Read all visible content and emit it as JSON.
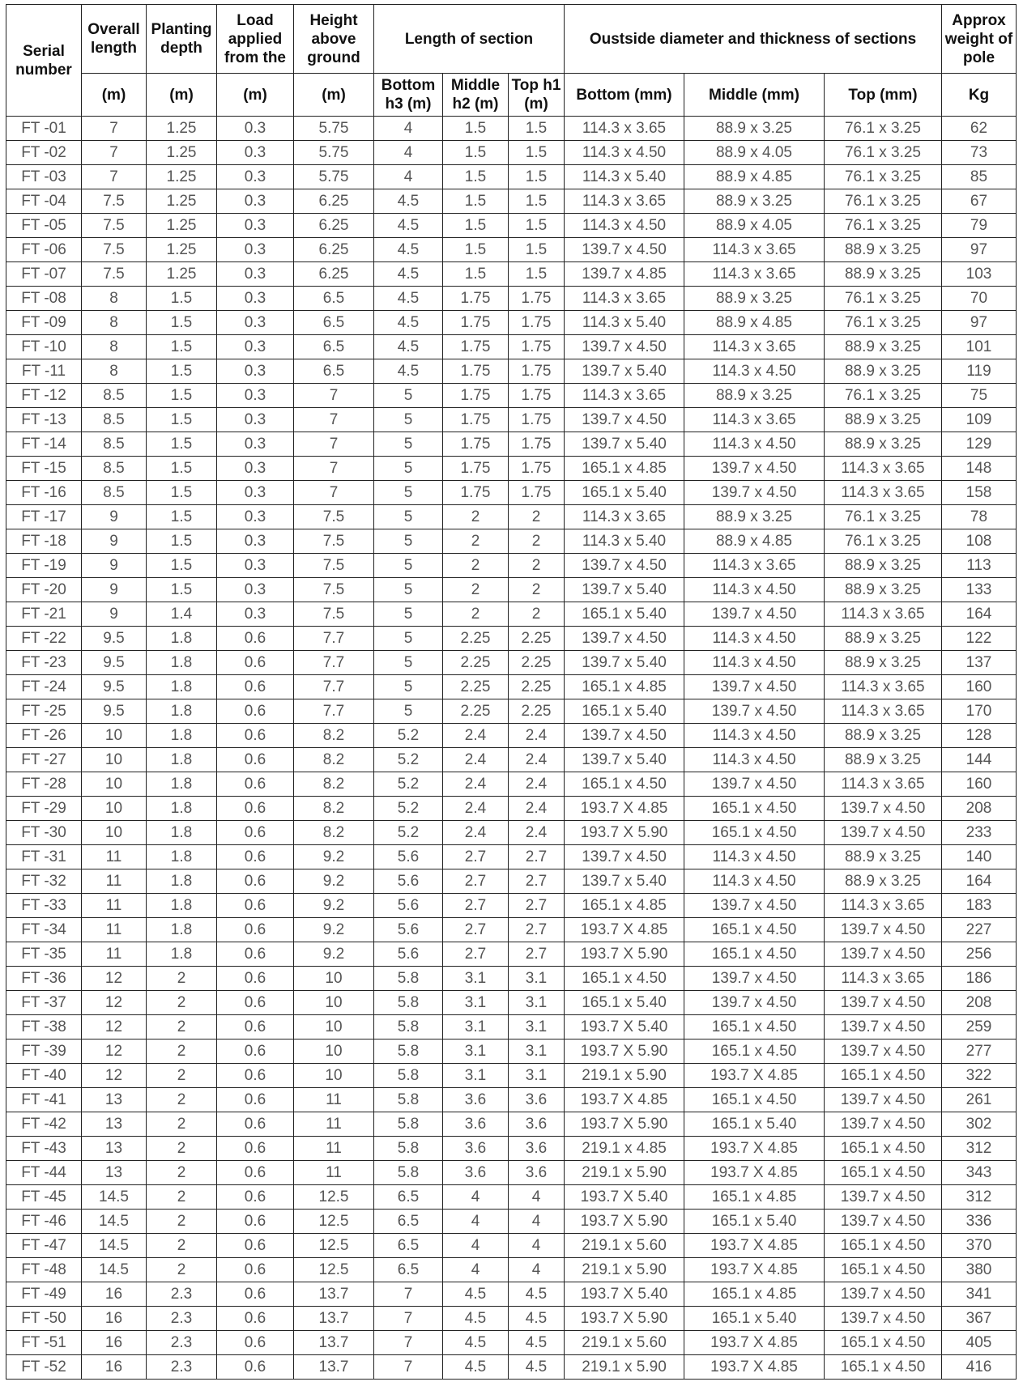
{
  "header": {
    "serial": "Serial number",
    "overall": "Overall length",
    "planting": "Planting depth",
    "load": "Load applied from the",
    "height": "Height above ground",
    "section_length": "Length of section",
    "diameter": "Oustside diameter and thickness of sections",
    "weight": "Approx weight of pole",
    "units": [
      "(m)",
      "(m)",
      "(m)",
      "(m)",
      "Bottom h3 (m)",
      "Middle h2 (m)",
      "Top h1 (m)",
      "Bottom (mm)",
      "Middle (mm)",
      "Top (mm)",
      "Kg"
    ]
  },
  "rows": [
    [
      "FT -01",
      "7",
      "1.25",
      "0.3",
      "5.75",
      "4",
      "1.5",
      "1.5",
      "114.3 x 3.65",
      "88.9 x 3.25",
      "76.1 x 3.25",
      "62"
    ],
    [
      "FT -02",
      "7",
      "1.25",
      "0.3",
      "5.75",
      "4",
      "1.5",
      "1.5",
      "114.3 x 4.50",
      "88.9 x 4.05",
      "76.1 x 3.25",
      "73"
    ],
    [
      "FT -03",
      "7",
      "1.25",
      "0.3",
      "5.75",
      "4",
      "1.5",
      "1.5",
      "114.3 x 5.40",
      "88.9 x 4.85",
      "76.1 x 3.25",
      "85"
    ],
    [
      "FT -04",
      "7.5",
      "1.25",
      "0.3",
      "6.25",
      "4.5",
      "1.5",
      "1.5",
      "114.3 x 3.65",
      "88.9 x 3.25",
      "76.1 x 3.25",
      "67"
    ],
    [
      "FT -05",
      "7.5",
      "1.25",
      "0.3",
      "6.25",
      "4.5",
      "1.5",
      "1.5",
      "114.3 x 4.50",
      "88.9 x 4.05",
      "76.1 x 3.25",
      "79"
    ],
    [
      "FT -06",
      "7.5",
      "1.25",
      "0.3",
      "6.25",
      "4.5",
      "1.5",
      "1.5",
      "139.7 x 4.50",
      "114.3 x 3.65",
      "88.9 x 3.25",
      "97"
    ],
    [
      "FT -07",
      "7.5",
      "1.25",
      "0.3",
      "6.25",
      "4.5",
      "1.5",
      "1.5",
      "139.7 x 4.85",
      "114.3 x 3.65",
      "88.9 x 3.25",
      "103"
    ],
    [
      "FT -08",
      "8",
      "1.5",
      "0.3",
      "6.5",
      "4.5",
      "1.75",
      "1.75",
      "114.3 x 3.65",
      "88.9 x 3.25",
      "76.1 x 3.25",
      "70"
    ],
    [
      "FT -09",
      "8",
      "1.5",
      "0.3",
      "6.5",
      "4.5",
      "1.75",
      "1.75",
      "114.3 x 5.40",
      "88.9 x 4.85",
      "76.1 x 3.25",
      "97"
    ],
    [
      "FT -10",
      "8",
      "1.5",
      "0.3",
      "6.5",
      "4.5",
      "1.75",
      "1.75",
      "139.7 x 4.50",
      "114.3 x 3.65",
      "88.9 x 3.25",
      "101"
    ],
    [
      "FT -11",
      "8",
      "1.5",
      "0.3",
      "6.5",
      "4.5",
      "1.75",
      "1.75",
      "139.7 x 5.40",
      "114.3 x 4.50",
      "88.9 x 3.25",
      "119"
    ],
    [
      "FT -12",
      "8.5",
      "1.5",
      "0.3",
      "7",
      "5",
      "1.75",
      "1.75",
      "114.3 x 3.65",
      "88.9 x 3.25",
      "76.1 x 3.25",
      "75"
    ],
    [
      "FT -13",
      "8.5",
      "1.5",
      "0.3",
      "7",
      "5",
      "1.75",
      "1.75",
      "139.7 x 4.50",
      "114.3 x 3.65",
      "88.9 x 3.25",
      "109"
    ],
    [
      "FT -14",
      "8.5",
      "1.5",
      "0.3",
      "7",
      "5",
      "1.75",
      "1.75",
      "139.7 x 5.40",
      "114.3 x 4.50",
      "88.9 x 3.25",
      "129"
    ],
    [
      "FT -15",
      "8.5",
      "1.5",
      "0.3",
      "7",
      "5",
      "1.75",
      "1.75",
      "165.1 x 4.85",
      "139.7 x 4.50",
      "114.3 x 3.65",
      "148"
    ],
    [
      "FT -16",
      "8.5",
      "1.5",
      "0.3",
      "7",
      "5",
      "1.75",
      "1.75",
      "165.1 x 5.40",
      "139.7 x 4.50",
      "114.3 x 3.65",
      "158"
    ],
    [
      "FT -17",
      "9",
      "1.5",
      "0.3",
      "7.5",
      "5",
      "2",
      "2",
      "114.3 x 3.65",
      "88.9 x 3.25",
      "76.1 x 3.25",
      "78"
    ],
    [
      "FT -18",
      "9",
      "1.5",
      "0.3",
      "7.5",
      "5",
      "2",
      "2",
      "114.3 x 5.40",
      "88.9 x 4.85",
      "76.1 x 3.25",
      "108"
    ],
    [
      "FT -19",
      "9",
      "1.5",
      "0.3",
      "7.5",
      "5",
      "2",
      "2",
      "139.7 x 4.50",
      "114.3 x 3.65",
      "88.9 x 3.25",
      "113"
    ],
    [
      "FT -20",
      "9",
      "1.5",
      "0.3",
      "7.5",
      "5",
      "2",
      "2",
      "139.7 x 5.40",
      "114.3 x 4.50",
      "88.9 x 3.25",
      "133"
    ],
    [
      "FT -21",
      "9",
      "1.4",
      "0.3",
      "7.5",
      "5",
      "2",
      "2",
      "165.1 x 5.40",
      "139.7 x 4.50",
      "114.3 x 3.65",
      "164"
    ],
    [
      "FT -22",
      "9.5",
      "1.8",
      "0.6",
      "7.7",
      "5",
      "2.25",
      "2.25",
      "139.7 x 4.50",
      "114.3 x 4.50",
      "88.9 x 3.25",
      "122"
    ],
    [
      "FT -23",
      "9.5",
      "1.8",
      "0.6",
      "7.7",
      "5",
      "2.25",
      "2.25",
      "139.7 x 5.40",
      "114.3 x 4.50",
      "88.9 x 3.25",
      "137"
    ],
    [
      "FT -24",
      "9.5",
      "1.8",
      "0.6",
      "7.7",
      "5",
      "2.25",
      "2.25",
      "165.1 x 4.85",
      "139.7 x 4.50",
      "114.3 x 3.65",
      "160"
    ],
    [
      "FT -25",
      "9.5",
      "1.8",
      "0.6",
      "7.7",
      "5",
      "2.25",
      "2.25",
      "165.1 x 5.40",
      "139.7 x 4.50",
      "114.3 x 3.65",
      "170"
    ],
    [
      "FT -26",
      "10",
      "1.8",
      "0.6",
      "8.2",
      "5.2",
      "2.4",
      "2.4",
      "139.7 x 4.50",
      "114.3 x 4.50",
      "88.9 x 3.25",
      "128"
    ],
    [
      "FT -27",
      "10",
      "1.8",
      "0.6",
      "8.2",
      "5.2",
      "2.4",
      "2.4",
      "139.7 x 5.40",
      "114.3 x 4.50",
      "88.9 x 3.25",
      "144"
    ],
    [
      "FT -28",
      "10",
      "1.8",
      "0.6",
      "8.2",
      "5.2",
      "2.4",
      "2.4",
      "165.1 x 4.50",
      "139.7 x 4.50",
      "114.3 x 3.65",
      "160"
    ],
    [
      "FT -29",
      "10",
      "1.8",
      "0.6",
      "8.2",
      "5.2",
      "2.4",
      "2.4",
      "193.7  X 4.85",
      "165.1 x 4.50",
      "139.7 x 4.50",
      "208"
    ],
    [
      "FT -30",
      "10",
      "1.8",
      "0.6",
      "8.2",
      "5.2",
      "2.4",
      "2.4",
      "193.7  X 5.90",
      "165.1 x 4.50",
      "139.7 x 4.50",
      "233"
    ],
    [
      "FT -31",
      "11",
      "1.8",
      "0.6",
      "9.2",
      "5.6",
      "2.7",
      "2.7",
      "139.7 x 4.50",
      "114.3 x 4.50",
      "88.9 x 3.25",
      "140"
    ],
    [
      "FT -32",
      "11",
      "1.8",
      "0.6",
      "9.2",
      "5.6",
      "2.7",
      "2.7",
      "139.7 x 5.40",
      "114.3 x 4.50",
      "88.9 x 3.25",
      "164"
    ],
    [
      "FT -33",
      "11",
      "1.8",
      "0.6",
      "9.2",
      "5.6",
      "2.7",
      "2.7",
      "165.1 x 4.85",
      "139.7 x 4.50",
      "114.3 x 3.65",
      "183"
    ],
    [
      "FT -34",
      "11",
      "1.8",
      "0.6",
      "9.2",
      "5.6",
      "2.7",
      "2.7",
      "193.7  X 4.85",
      "165.1 x 4.50",
      "139.7 x 4.50",
      "227"
    ],
    [
      "FT -35",
      "11",
      "1.8",
      "0.6",
      "9.2",
      "5.6",
      "2.7",
      "2.7",
      "193.7  X 5.90",
      "165.1 x 4.50",
      "139.7 x 4.50",
      "256"
    ],
    [
      "FT -36",
      "12",
      "2",
      "0.6",
      "10",
      "5.8",
      "3.1",
      "3.1",
      "165.1 x 4.50",
      "139.7 x 4.50",
      "114.3 x 3.65",
      "186"
    ],
    [
      "FT -37",
      "12",
      "2",
      "0.6",
      "10",
      "5.8",
      "3.1",
      "3.1",
      "165.1 x 5.40",
      "139.7 x 4.50",
      "139.7 x 4.50",
      "208"
    ],
    [
      "FT -38",
      "12",
      "2",
      "0.6",
      "10",
      "5.8",
      "3.1",
      "3.1",
      "193.7 X 5.40",
      "165.1 x 4.50",
      "139.7 x 4.50",
      "259"
    ],
    [
      "FT -39",
      "12",
      "2",
      "0.6",
      "10",
      "5.8",
      "3.1",
      "3.1",
      "193.7  X 5.90",
      "165.1 x 4.50",
      "139.7 x 4.50",
      "277"
    ],
    [
      "FT -40",
      "12",
      "2",
      "0.6",
      "10",
      "5.8",
      "3.1",
      "3.1",
      "219.1 x 5.90",
      "193.7  X 4.85",
      "165.1 x 4.50",
      "322"
    ],
    [
      "FT -41",
      "13",
      "2",
      "0.6",
      "11",
      "5.8",
      "3.6",
      "3.6",
      "193.7  X 4.85",
      "165.1 x 4.50",
      "139.7 x 4.50",
      "261"
    ],
    [
      "FT -42",
      "13",
      "2",
      "0.6",
      "11",
      "5.8",
      "3.6",
      "3.6",
      "193.7  X 5.90",
      "165.1 x 5.40",
      "139.7 x 4.50",
      "302"
    ],
    [
      "FT -43",
      "13",
      "2",
      "0.6",
      "11",
      "5.8",
      "3.6",
      "3.6",
      "219.1 x 4.85",
      "193.7  X 4.85",
      "165.1 x 4.50",
      "312"
    ],
    [
      "FT -44",
      "13",
      "2",
      "0.6",
      "11",
      "5.8",
      "3.6",
      "3.6",
      "219.1 x 5.90",
      "193.7  X 4.85",
      "165.1 x 4.50",
      "343"
    ],
    [
      "FT -45",
      "14.5",
      "2",
      "0.6",
      "12.5",
      "6.5",
      "4",
      "4",
      "193.7 X 5.40",
      "165.1 x 4.85",
      "139.7 x 4.50",
      "312"
    ],
    [
      "FT -46",
      "14.5",
      "2",
      "0.6",
      "12.5",
      "6.5",
      "4",
      "4",
      "193.7  X 5.90",
      "165.1 x 5.40",
      "139.7 x 4.50",
      "336"
    ],
    [
      "FT -47",
      "14.5",
      "2",
      "0.6",
      "12.5",
      "6.5",
      "4",
      "4",
      "219.1 x 5.60",
      "193.7  X 4.85",
      "165.1 x 4.50",
      "370"
    ],
    [
      "FT -48",
      "14.5",
      "2",
      "0.6",
      "12.5",
      "6.5",
      "4",
      "4",
      "219.1 x 5.90",
      "193.7  X 4.85",
      "165.1 x 4.50",
      "380"
    ],
    [
      "FT -49",
      "16",
      "2.3",
      "0.6",
      "13.7",
      "7",
      "4.5",
      "4.5",
      "193.7 X 5.40",
      "165.1 x 4.85",
      "139.7 x 4.50",
      "341"
    ],
    [
      "FT -50",
      "16",
      "2.3",
      "0.6",
      "13.7",
      "7",
      "4.5",
      "4.5",
      "193.7  X 5.90",
      "165.1 x 5.40",
      "139.7 x 4.50",
      "367"
    ],
    [
      "FT -51",
      "16",
      "2.3",
      "0.6",
      "13.7",
      "7",
      "4.5",
      "4.5",
      "219.1 x 5.60",
      "193.7  X 4.85",
      "165.1 x 4.50",
      "405"
    ],
    [
      "FT -52",
      "16",
      "2.3",
      "0.6",
      "13.7",
      "7",
      "4.5",
      "4.5",
      "219.1 x 5.90",
      "193.7  X 4.85",
      "165.1 x 4.50",
      "416"
    ]
  ]
}
